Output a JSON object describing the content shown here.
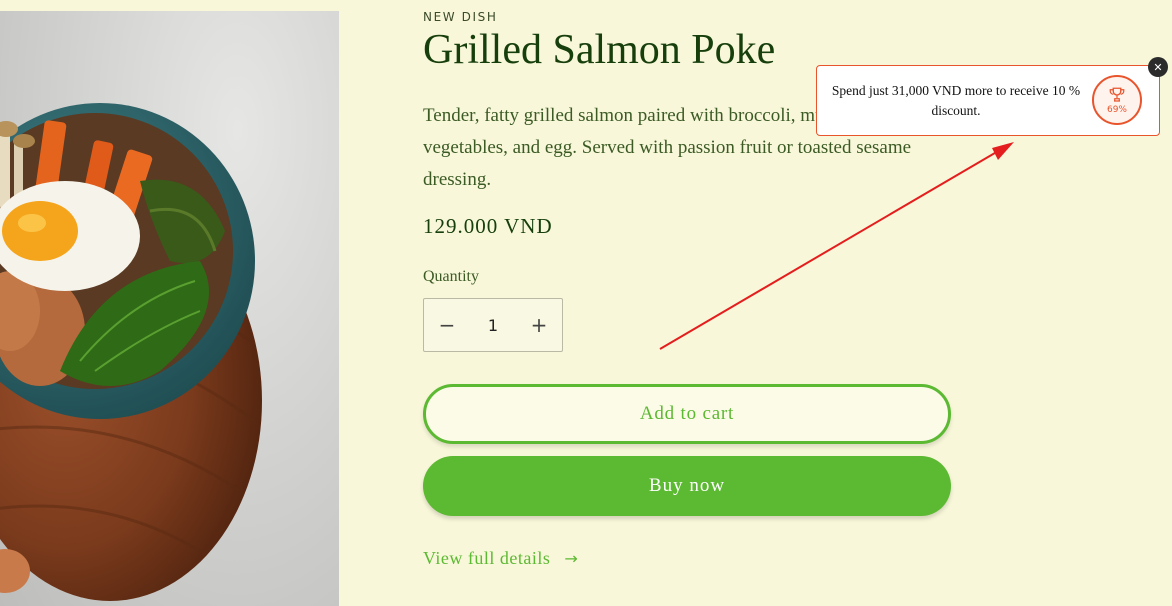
{
  "product": {
    "eyebrow": "NEW DISH",
    "title": "Grilled Salmon Poke",
    "description": "Tender, fatty grilled salmon paired with broccoli, mushrooms, fresh vegetables, and egg. Served with passion fruit or toasted sesame dressing.",
    "price": "129.000 VND",
    "image_icon": "poke-bowl-photo"
  },
  "quantity": {
    "label": "Quantity",
    "value": "1",
    "decrease_icon": "minus-icon",
    "increase_icon": "plus-icon"
  },
  "actions": {
    "add_to_cart": "Add to cart",
    "buy_now": "Buy now",
    "view_details": "View full details"
  },
  "discount_popup": {
    "message": "Spend just 31,000 VND more to receive 10 % discount.",
    "progress_label": "69%",
    "progress": 0.69,
    "icon": "trophy-icon",
    "close_icon": "close-icon"
  },
  "colors": {
    "accent_green": "#5cb932",
    "page_bg": "#f8f7d9",
    "popup_border": "#e8542c",
    "annotation_arrow": "#e41e1e"
  }
}
